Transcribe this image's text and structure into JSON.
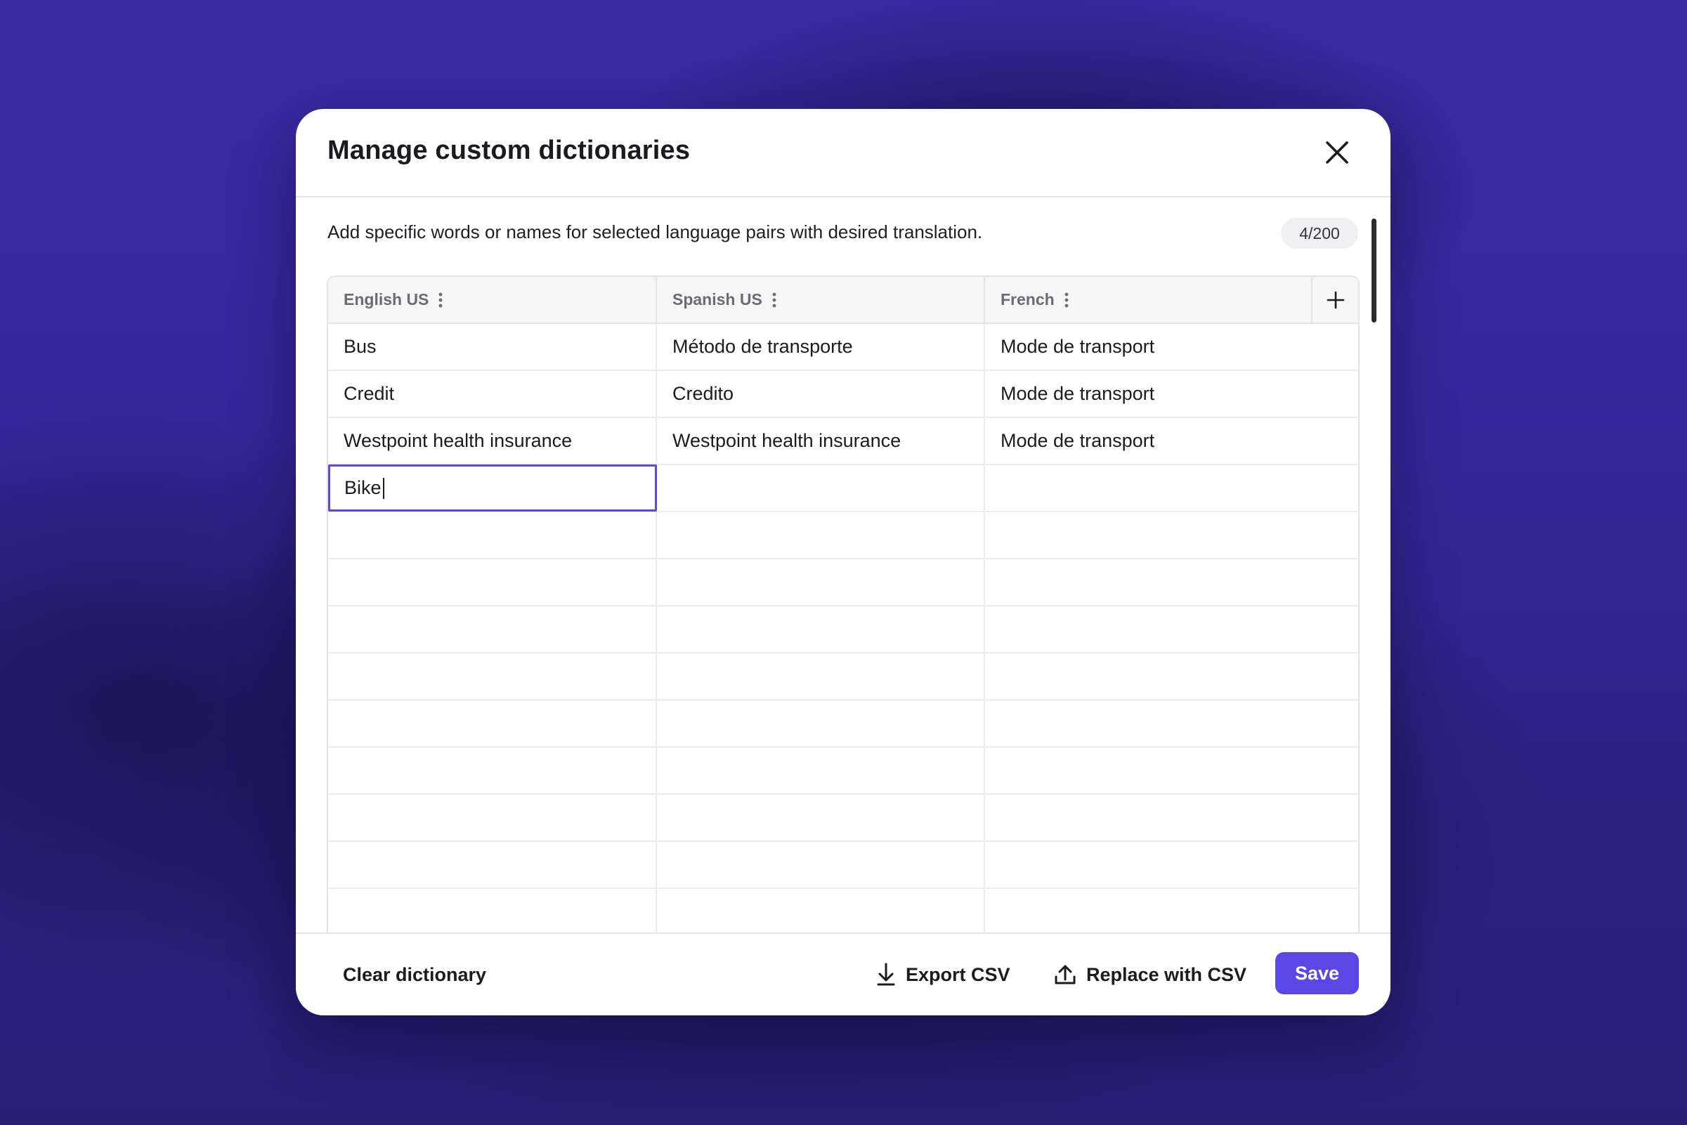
{
  "modal": {
    "title": "Manage custom dictionaries",
    "description": "Add specific words or names for selected language pairs with desired translation.",
    "counter": "4/200"
  },
  "table": {
    "columns": [
      {
        "label": "English US"
      },
      {
        "label": "Spanish US"
      },
      {
        "label": "French"
      }
    ],
    "rows": [
      [
        "Bus",
        "Método de transporte",
        "Mode de transport"
      ],
      [
        "Credit",
        "Credito",
        "Mode de transport"
      ],
      [
        "Westpoint health insurance",
        "Westpoint health insurance",
        "Mode de transport"
      ],
      [
        "Bike",
        "",
        ""
      ]
    ],
    "empty_rows": 9,
    "editing_value": "Bike"
  },
  "footer": {
    "clear_label": "Clear dictionary",
    "export_label": "Export CSV",
    "replace_label": "Replace with CSV",
    "save_label": "Save"
  },
  "icons": {
    "close": "close-icon",
    "column_menu": "kebab-menu-icon",
    "add_column": "plus-icon",
    "export": "download-icon",
    "replace": "upload-icon"
  },
  "colors": {
    "accent": "#5a47e6",
    "background": "#3a2ba4"
  }
}
